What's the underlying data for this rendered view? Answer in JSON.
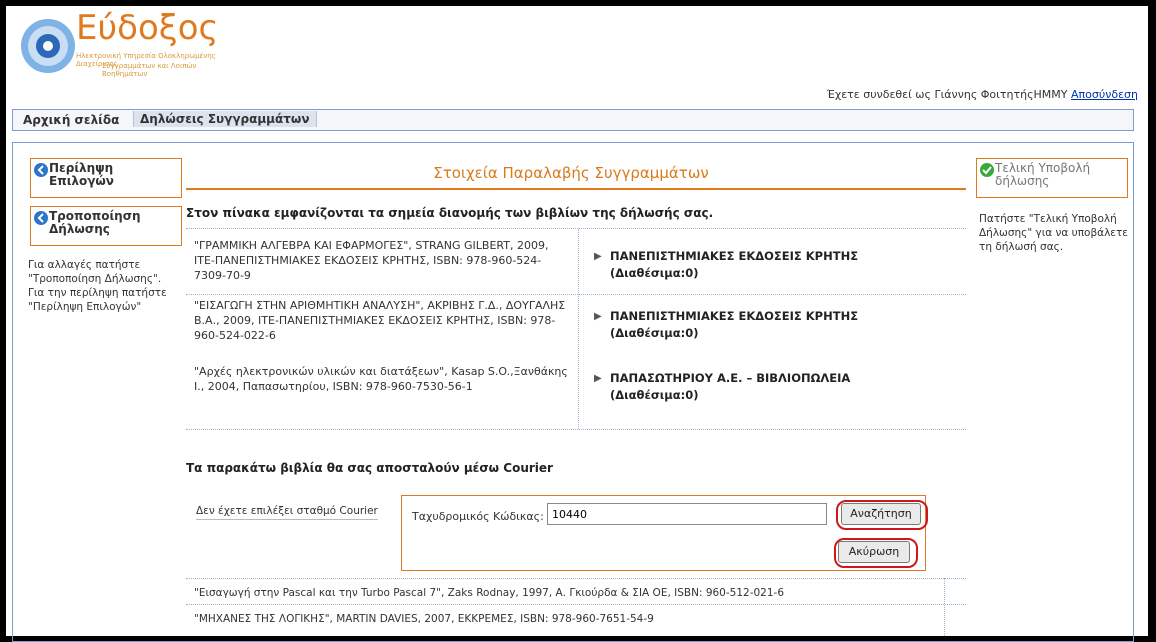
{
  "header": {
    "logo_title": "Εύδοξος",
    "logo_sub1": "Ηλεκτρονική Υπηρεσία Ολοκληρωμένης Διαχείρισης",
    "logo_sub2": "Συγγραμμάτων και Λοιπών Βοηθημάτων",
    "user_prefix": "Έχετε συνδεθεί ως Γιάννης ΦοιτητήςΗΜΜΥ",
    "logout": "Αποσύνδεση"
  },
  "nav": {
    "home": "Αρχική σελίδα",
    "declarations": "Δηλώσεις Συγγραμμάτων"
  },
  "left": {
    "summary_btn": "Περίληψη Επιλογών",
    "modify_btn": "Τροποποίηση Δήλωσης",
    "note": "Για αλλαγές πατήστε \"Τροποποίηση Δήλωσης\". Για την περίληψη πατήστε \"Περίληψη Επιλογών\""
  },
  "right": {
    "submit_btn": "Τελική Υποβολή δήλωσης",
    "note": "Πατήστε \"Τελική Υποβολή Δήλωσης\" για να υποβάλετε τη δήλωσή σας."
  },
  "main": {
    "title": "Στοιχεία Παραλαβής Συγγραμμάτων",
    "intro": "Στον πίνακα εμφανίζονται τα σημεία διανομής των βιβλίων της δήλωσής σας.",
    "rows": [
      {
        "book": "\"ΓΡΑΜΜΙΚΗ ΑΛΓΕΒΡΑ ΚΑΙ ΕΦΑΡΜΟΓΕΣ\", STRANG GILBERT, 2009, ΙΤΕ-ΠΑΝΕΠΙΣΤΗΜΙΑΚΕΣ ΕΚΔΟΣΕΙΣ ΚΡΗΤΗΣ, ISBN: 978-960-524-7309-70-9",
        "vendor": "ΠΑΝΕΠΙΣΤΗΜΙΑΚΕΣ ΕΚΔΟΣΕΙΣ ΚΡΗΤΗΣ",
        "avail": "(Διαθέσιμα:0)"
      },
      {
        "book": "\"ΕΙΣΑΓΩΓΗ ΣΤΗΝ ΑΡΙΘΜΗΤΙΚΗ ΑΝΑΛΥΣΗ\", ΑΚΡΙΒΗΣ Γ.Δ., ΔΟΥΓΑΛΗΣ Β.Α., 2009, ΙΤΕ-ΠΑΝΕΠΙΣΤΗΜΙΑΚΕΣ ΕΚΔΟΣΕΙΣ ΚΡΗΤΗΣ, ISBN: 978-960-524-022-6",
        "vendor": "ΠΑΝΕΠΙΣΤΗΜΙΑΚΕΣ ΕΚΔΟΣΕΙΣ ΚΡΗΤΗΣ",
        "avail": "(Διαθέσιμα:0)"
      },
      {
        "book": "\"Αρχές ηλεκτρονικών υλικών και διατάξεων\", Kasap S.O.,Ξανθάκης Ι., 2004, Παπασωτηρίου, ISBN: 978-960-7530-56-1",
        "vendor": "ΠΑΠΑΣΩΤΗΡΙΟΥ Α.Ε. – ΒΙΒΛΙΟΠΩΛΕΙΑ",
        "avail": "(Διαθέσιμα:0)"
      }
    ],
    "courier_title": "Τα παρακάτω βιβλία θα σας αποσταλούν μέσω Courier",
    "no_station": "Δεν έχετε επιλέξει σταθμό Courier",
    "zip_label": "Ταχυδρομικός Κώδικας:",
    "zip_value": "10440",
    "search_btn": "Αναζήτηση",
    "cancel_btn": "Ακύρωση",
    "courier_books": [
      "\"Εισαγωγή στην Pascal και την Turbo Pascal 7\", Zaks Rodnay, 1997, Α. Γκιούρδα & ΣΙΑ ΟΕ, ISBN: 960-512-021-6",
      "\"ΜΗΧΑΝΕΣ ΤΗΣ ΛΟΓΙΚΗΣ\", MARTIN DAVIES, 2007, ΕΚΚΡΕΜΕΣ, ISBN: 978-960-7651-54-9"
    ]
  }
}
